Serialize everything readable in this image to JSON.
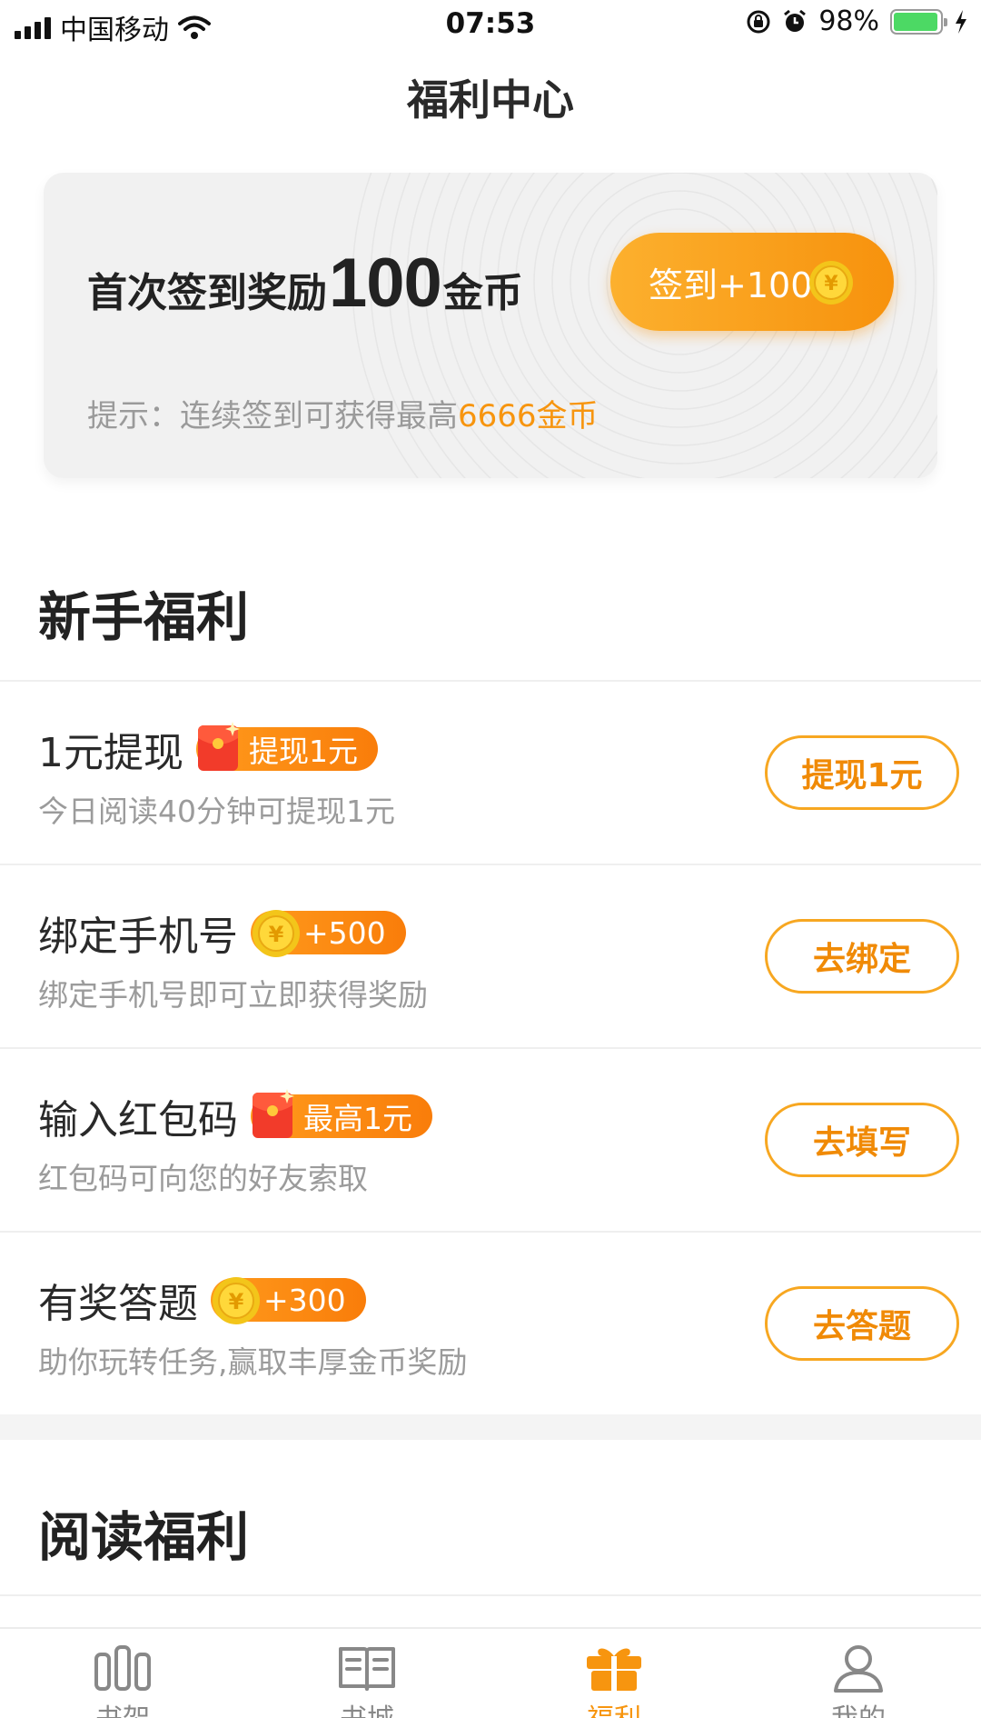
{
  "status_bar": {
    "carrier": "中国移动",
    "time": "07:53",
    "battery": "98%"
  },
  "header": {
    "title": "福利中心"
  },
  "signin": {
    "headline_prefix": "首次签到奖励",
    "headline_amount": "100",
    "headline_suffix": "金币",
    "button_label": "签到+100",
    "tip_prefix": "提示：连续签到可获得最高",
    "tip_highlight": "6666金币"
  },
  "newbie": {
    "section_title": "新手福利",
    "items": [
      {
        "title": "1元提现",
        "badge": "提现1元",
        "badge_icon": "red-packet-icon",
        "desc": "今日阅读40分钟可提现1元",
        "action": "提现1元"
      },
      {
        "title": "绑定手机号",
        "badge": "+500",
        "badge_icon": "gold-coin-icon",
        "desc": "绑定手机号即可立即获得奖励",
        "action": "去绑定"
      },
      {
        "title": "输入红包码",
        "badge": "最高1元",
        "badge_icon": "red-packet-icon",
        "desc": "红包码可向您的好友索取",
        "action": "去填写"
      },
      {
        "title": "有奖答题",
        "badge": "+300",
        "badge_icon": "gold-coin-icon",
        "desc": "助你玩转任务,赢取丰厚金币奖励",
        "action": "去答题"
      }
    ]
  },
  "reading": {
    "section_title": "阅读福利"
  },
  "tab_bar": {
    "tabs": [
      {
        "label": "书架",
        "icon": "bookshelf-icon"
      },
      {
        "label": "书城",
        "icon": "book-open-icon"
      },
      {
        "label": "福利",
        "icon": "gift-icon",
        "active": true
      },
      {
        "label": "我的",
        "icon": "user-icon"
      }
    ]
  },
  "colors": {
    "accent": "#f7950f",
    "accent_light": "#fcb02e",
    "battery": "#4cd964"
  }
}
